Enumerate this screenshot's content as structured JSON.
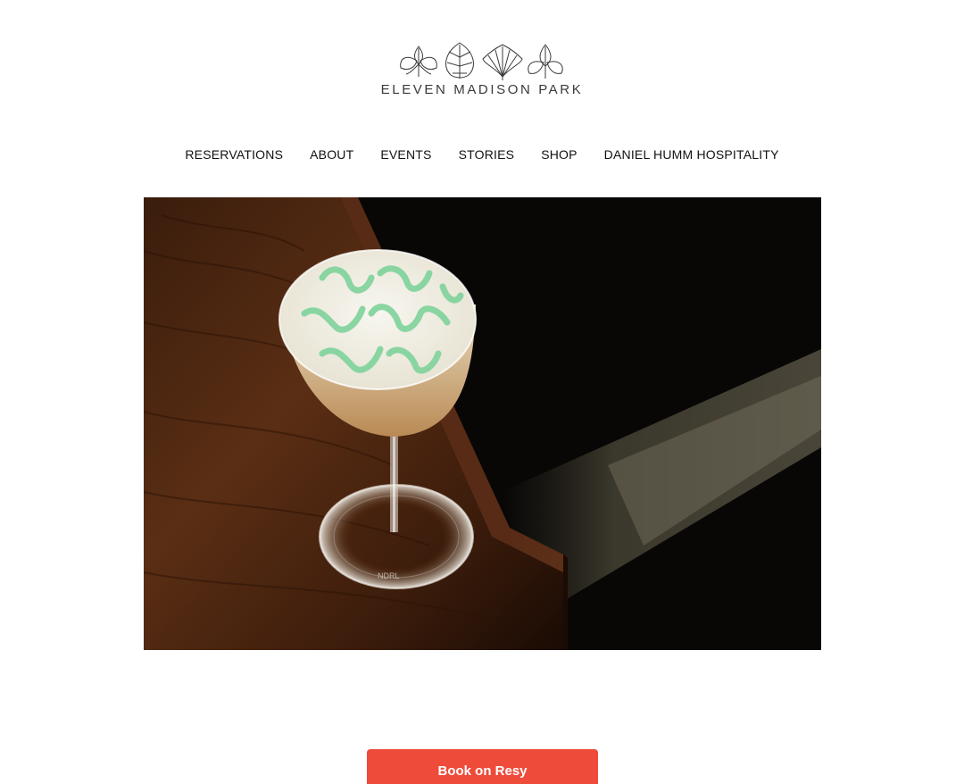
{
  "header": {
    "brand_name": "ELEVEN MADISON PARK"
  },
  "nav": {
    "items": [
      {
        "label": "RESERVATIONS"
      },
      {
        "label": "ABOUT"
      },
      {
        "label": "EVENTS"
      },
      {
        "label": "STORIES"
      },
      {
        "label": "SHOP"
      },
      {
        "label": "DANIEL HUMM HOSPITALITY"
      }
    ]
  },
  "hero": {
    "glass_base_mark": "NDRL"
  },
  "cta": {
    "label": "Book on Resy",
    "color": "#ef4b3b"
  },
  "colors": {
    "background": "#ffffff",
    "text": "#111111",
    "accent": "#ef4b3b",
    "cocktail_green": "#7fd39b"
  }
}
